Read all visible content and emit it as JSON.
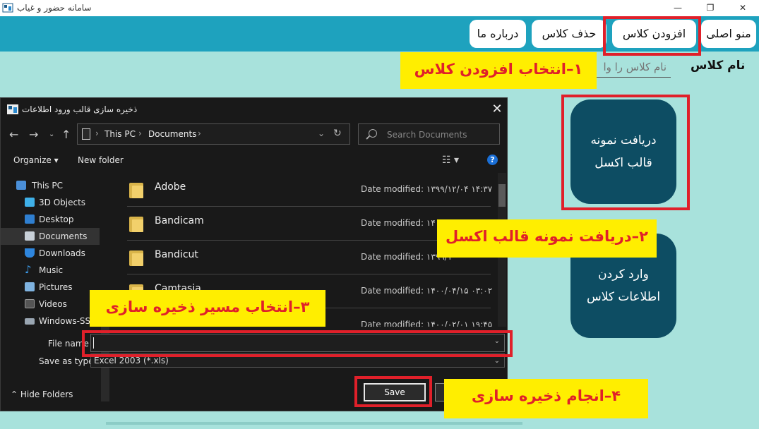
{
  "app": {
    "title": "سامانه حضور و غیاب",
    "win_min": "—",
    "win_max": "❐",
    "win_close": "✕"
  },
  "menu": {
    "home": "منو اصلی",
    "add_class": "افزودن کلاس",
    "delete_class": "حذف کلاس",
    "about": "درباره ما"
  },
  "form": {
    "class_name_label": "نام کلاس",
    "class_name_placeholder": "نام کلاس را وا"
  },
  "buttons": {
    "get_template": "دریافت نمونه قالب اکسل",
    "enter_info": "وارد کردن اطلاعات کلاس"
  },
  "callouts": {
    "step1": "۱–انتخاب افزودن کلاس",
    "step2": "۲–دریافت نمونه قالب اکسل",
    "step3": "۳–انتخاب مسیر ذخیره سازی",
    "step4": "۴–انجام ذخیره سازی"
  },
  "dialog": {
    "title": "ذخیره سازی قالب ورود اطلاعات",
    "close": "✕",
    "address": {
      "root": "This PC",
      "folder": "Documents"
    },
    "search_placeholder": "Search Documents",
    "organize": "Organize ▾",
    "new_folder": "New folder",
    "nav_items": [
      {
        "label": "This PC",
        "icon": "pc-icon"
      },
      {
        "label": "3D Objects",
        "icon": "cube-icon"
      },
      {
        "label": "Desktop",
        "icon": "desktop-icon"
      },
      {
        "label": "Documents",
        "icon": "document-icon",
        "selected": true
      },
      {
        "label": "Downloads",
        "icon": "download-icon"
      },
      {
        "label": "Music",
        "icon": "music-icon"
      },
      {
        "label": "Pictures",
        "icon": "picture-icon"
      },
      {
        "label": "Videos",
        "icon": "video-icon"
      },
      {
        "label": "Windows-SSD",
        "icon": "drive-icon"
      }
    ],
    "files": [
      {
        "name": "Adobe",
        "date": "Date modified: ۱۳۹۹/۱۲/۰۴ ۱۴:۳۷"
      },
      {
        "name": "Bandicam",
        "date": "Date modified: ۱۴۰۰/۰"
      },
      {
        "name": "Bandicut",
        "date": "Date modified: ۱۳۹۹/۱"
      },
      {
        "name": "Camtasia",
        "date": "Date modified: ۱۴۰۰/۰۴/۱۵ ۰۳:۰۲"
      },
      {
        "name": "",
        "date": "Date modified: ۱۴۰۰/۰۲/۰۱ ۱۹:۴۵"
      }
    ],
    "file_name_label": "File name",
    "save_as_type_label": "Save as type:",
    "save_as_type_value": "Excel 2003 (*.xls)",
    "hide_folders": "Hide Folders",
    "save_button": "Save",
    "cancel_button": ""
  },
  "colors": {
    "background": "#a8e2dc",
    "menubar": "#1ea2be",
    "big_button": "#0d4d63",
    "highlight": "#e0202a",
    "callout": "#ffee00",
    "dialog_bg": "#191919"
  }
}
